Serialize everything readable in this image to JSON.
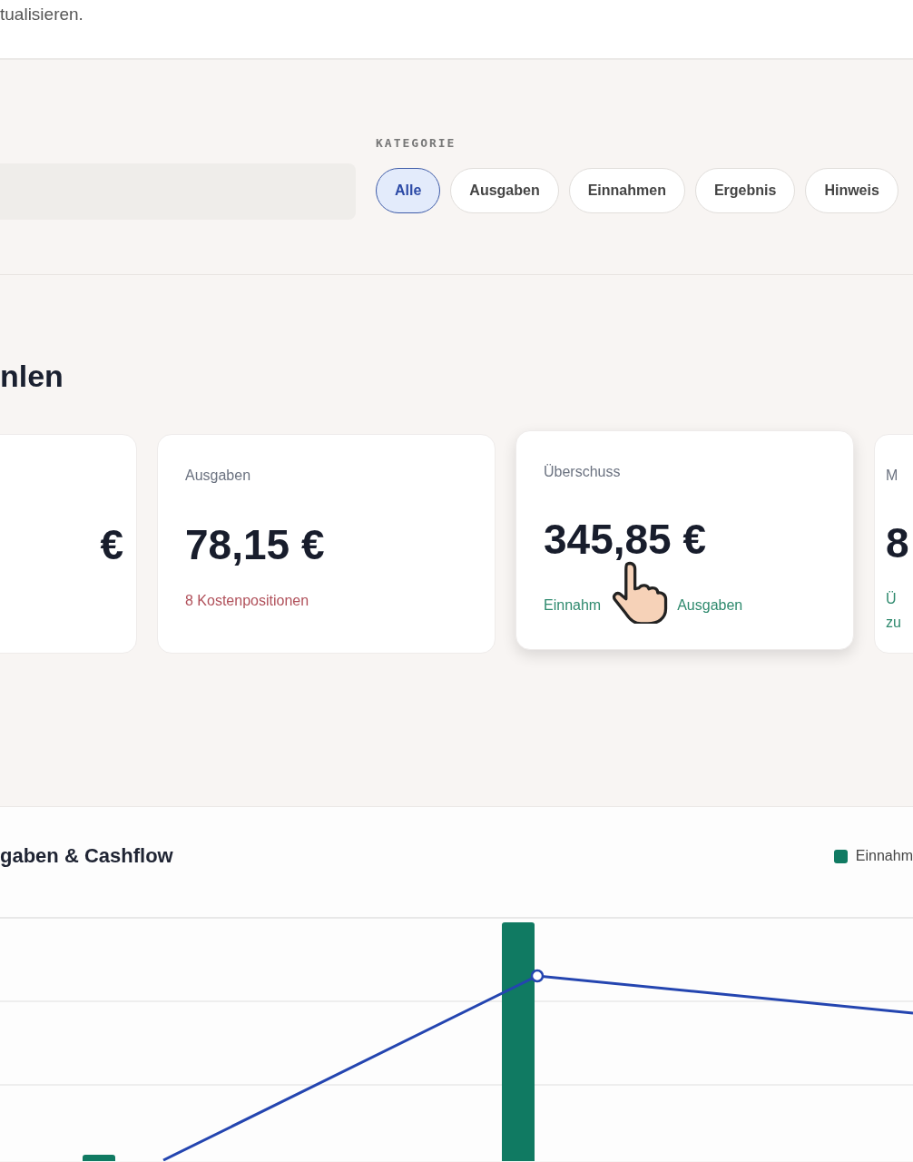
{
  "intro_text": "tualisieren.",
  "filters": {
    "category_label": "KATEGORIE",
    "chips": [
      {
        "label": "Alle",
        "selected": true
      },
      {
        "label": "Ausgaben",
        "selected": false
      },
      {
        "label": "Einnahmen",
        "selected": false
      },
      {
        "label": "Ergebnis",
        "selected": false
      },
      {
        "label": "Hinweis",
        "selected": false
      }
    ]
  },
  "section_heading": "nlen",
  "cards": [
    {
      "value": "€",
      "hovered": false
    },
    {
      "label": "Ausgaben",
      "value": "78,15 €",
      "note": {
        "color": "#b0505a",
        "lines": [
          "8 Kostenpositionen"
        ]
      },
      "hovered": false
    },
    {
      "label": "Überschuss",
      "value": "345,85 €",
      "note": {
        "color": "#2f8a6e",
        "lines": [
          "Einnahm",
          "Ausgaben"
        ]
      },
      "hovered": true,
      "cursor": true
    },
    {
      "label": "M",
      "value": "8",
      "note": {
        "color": "#2f8a6e",
        "lines": [
          "Ü",
          "zu"
        ]
      },
      "hovered": false
    }
  ],
  "chart": {
    "title": "gaben & Cashflow",
    "legend": [
      {
        "label": "Einnahm",
        "color": "#107a62"
      }
    ]
  }
}
